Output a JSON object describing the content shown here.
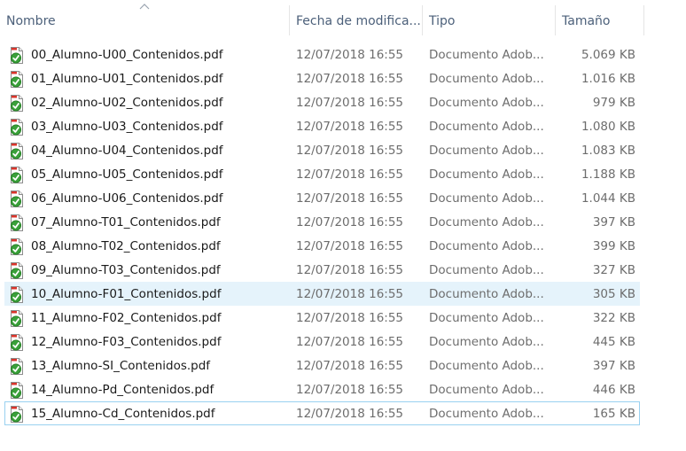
{
  "columns": {
    "name": "Nombre",
    "date": "Fecha de modifica...",
    "type": "Tipo",
    "size": "Tamaño"
  },
  "file_icon": "pdf-document-icon",
  "selection_color": "#e5f3fb",
  "files": [
    {
      "name": "00_Alumno-U00_Contenidos.pdf",
      "date": "12/07/2018 16:55",
      "type": "Documento Adob...",
      "size": "5.069 KB"
    },
    {
      "name": "01_Alumno-U01_Contenidos.pdf",
      "date": "12/07/2018 16:55",
      "type": "Documento Adob...",
      "size": "1.016 KB"
    },
    {
      "name": "02_Alumno-U02_Contenidos.pdf",
      "date": "12/07/2018 16:55",
      "type": "Documento Adob...",
      "size": "979 KB"
    },
    {
      "name": "03_Alumno-U03_Contenidos.pdf",
      "date": "12/07/2018 16:55",
      "type": "Documento Adob...",
      "size": "1.080 KB"
    },
    {
      "name": "04_Alumno-U04_Contenidos.pdf",
      "date": "12/07/2018 16:55",
      "type": "Documento Adob...",
      "size": "1.083 KB"
    },
    {
      "name": "05_Alumno-U05_Contenidos.pdf",
      "date": "12/07/2018 16:55",
      "type": "Documento Adob...",
      "size": "1.188 KB"
    },
    {
      "name": "06_Alumno-U06_Contenidos.pdf",
      "date": "12/07/2018 16:55",
      "type": "Documento Adob...",
      "size": "1.044 KB"
    },
    {
      "name": "07_Alumno-T01_Contenidos.pdf",
      "date": "12/07/2018 16:55",
      "type": "Documento Adob...",
      "size": "397 KB"
    },
    {
      "name": "08_Alumno-T02_Contenidos.pdf",
      "date": "12/07/2018 16:55",
      "type": "Documento Adob...",
      "size": "399 KB"
    },
    {
      "name": "09_Alumno-T03_Contenidos.pdf",
      "date": "12/07/2018 16:55",
      "type": "Documento Adob...",
      "size": "327 KB"
    },
    {
      "name": "10_Alumno-F01_Contenidos.pdf",
      "date": "12/07/2018 16:55",
      "type": "Documento Adob...",
      "size": "305 KB"
    },
    {
      "name": "11_Alumno-F02_Contenidos.pdf",
      "date": "12/07/2018 16:55",
      "type": "Documento Adob...",
      "size": "322 KB"
    },
    {
      "name": "12_Alumno-F03_Contenidos.pdf",
      "date": "12/07/2018 16:55",
      "type": "Documento Adob...",
      "size": "445 KB"
    },
    {
      "name": "13_Alumno-SI_Contenidos.pdf",
      "date": "12/07/2018 16:55",
      "type": "Documento Adob...",
      "size": "397 KB"
    },
    {
      "name": "14_Alumno-Pd_Contenidos.pdf",
      "date": "12/07/2018 16:55",
      "type": "Documento Adob...",
      "size": "446 KB"
    },
    {
      "name": "15_Alumno-Cd_Contenidos.pdf",
      "date": "12/07/2018 16:55",
      "type": "Documento Adob...",
      "size": "165 KB"
    }
  ]
}
